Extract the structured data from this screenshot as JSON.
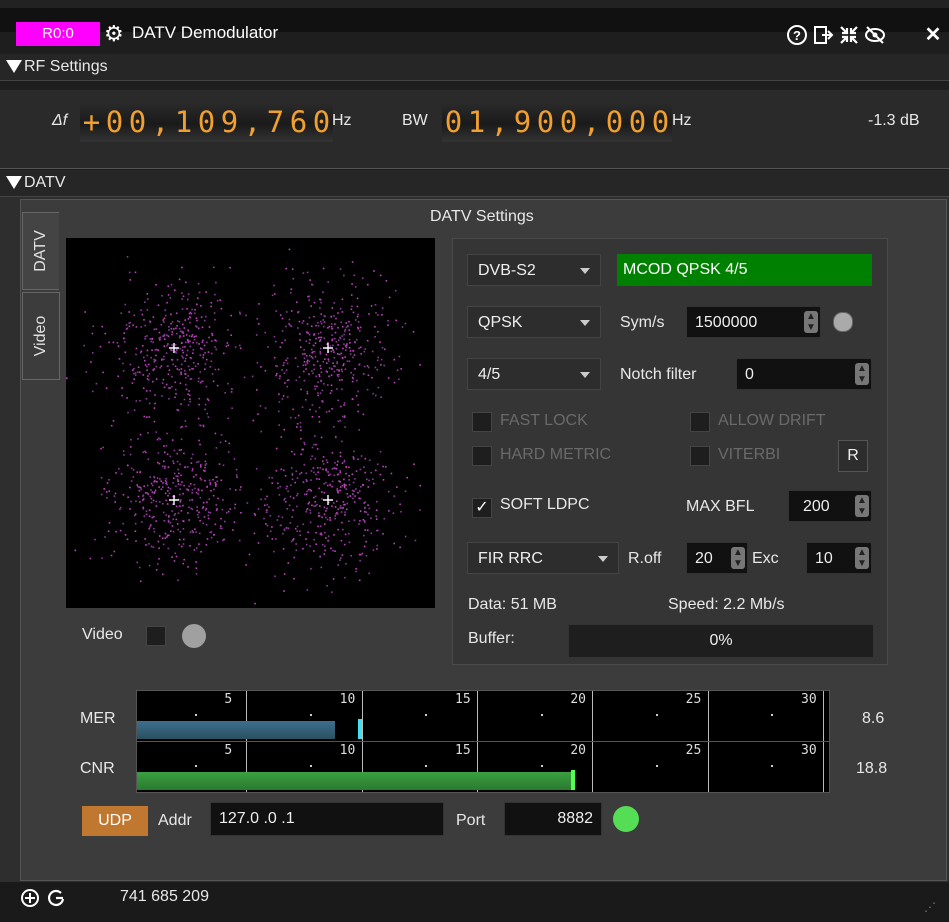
{
  "window": {
    "badge": "R0:0",
    "title": "DATV Demodulator",
    "icons": [
      "help-icon",
      "move-to-icon",
      "shrink-icon",
      "hide-icon",
      "close-icon"
    ]
  },
  "rf": {
    "section_label": "RF Settings",
    "delta_label": "Δf",
    "delta_value": "+00,109,760",
    "delta_unit": "Hz",
    "bw_label": "BW",
    "bw_value": "01,900,000",
    "bw_unit": "Hz",
    "power": "-1.3 dB"
  },
  "datv": {
    "section_label": "DATV",
    "tabs": [
      "DATV",
      "Video"
    ],
    "settings_title": "DATV Settings",
    "standard": "DVB-S2",
    "modcod_status": "MCOD QPSK 4/5",
    "modulation": "QPSK",
    "symrate_label": "Sym/s",
    "symrate_value": "1500000",
    "fec": "4/5",
    "notch_label": "Notch filter",
    "notch_value": "0",
    "fast_lock": "FAST LOCK",
    "allow_drift": "ALLOW DRIFT",
    "hard_metric": "HARD METRIC",
    "viterbi": "VITERBI",
    "reset_label": "R",
    "soft_ldpc": "SOFT LDPC",
    "soft_ldpc_check": "✓",
    "max_bfl_label": "MAX BFL",
    "max_bfl_value": "200",
    "filter": "FIR RRC",
    "roff_label": "R.off",
    "roff_value": "20",
    "exc_label": "Exc",
    "exc_value": "10",
    "data_text": "Data: 51 MB",
    "speed_text": "Speed: 2.2 Mb/s",
    "buffer_label": "Buffer:",
    "buffer_value": "0%",
    "video_label": "Video",
    "colors": {
      "modcod_bg": "#008000",
      "video_led": "#a0a0a0",
      "udp_led": "#55dd55",
      "badge": "#ff00ff"
    }
  },
  "meters": {
    "ticks": [
      "5",
      "10",
      "15",
      "20",
      "25",
      "30"
    ],
    "mer": {
      "label": "MER",
      "value_text": "8.6",
      "value": 8.6,
      "peak": 9.6
    },
    "cnr": {
      "label": "CNR",
      "value_text": "18.8",
      "value": 18.8,
      "peak": 18.8
    }
  },
  "udp": {
    "button": "UDP",
    "addr_label": "Addr",
    "addr_value": "127.0 .0 .1",
    "port_label": "Port",
    "port_value": "8882"
  },
  "status": {
    "frequency": "741 685 209"
  }
}
